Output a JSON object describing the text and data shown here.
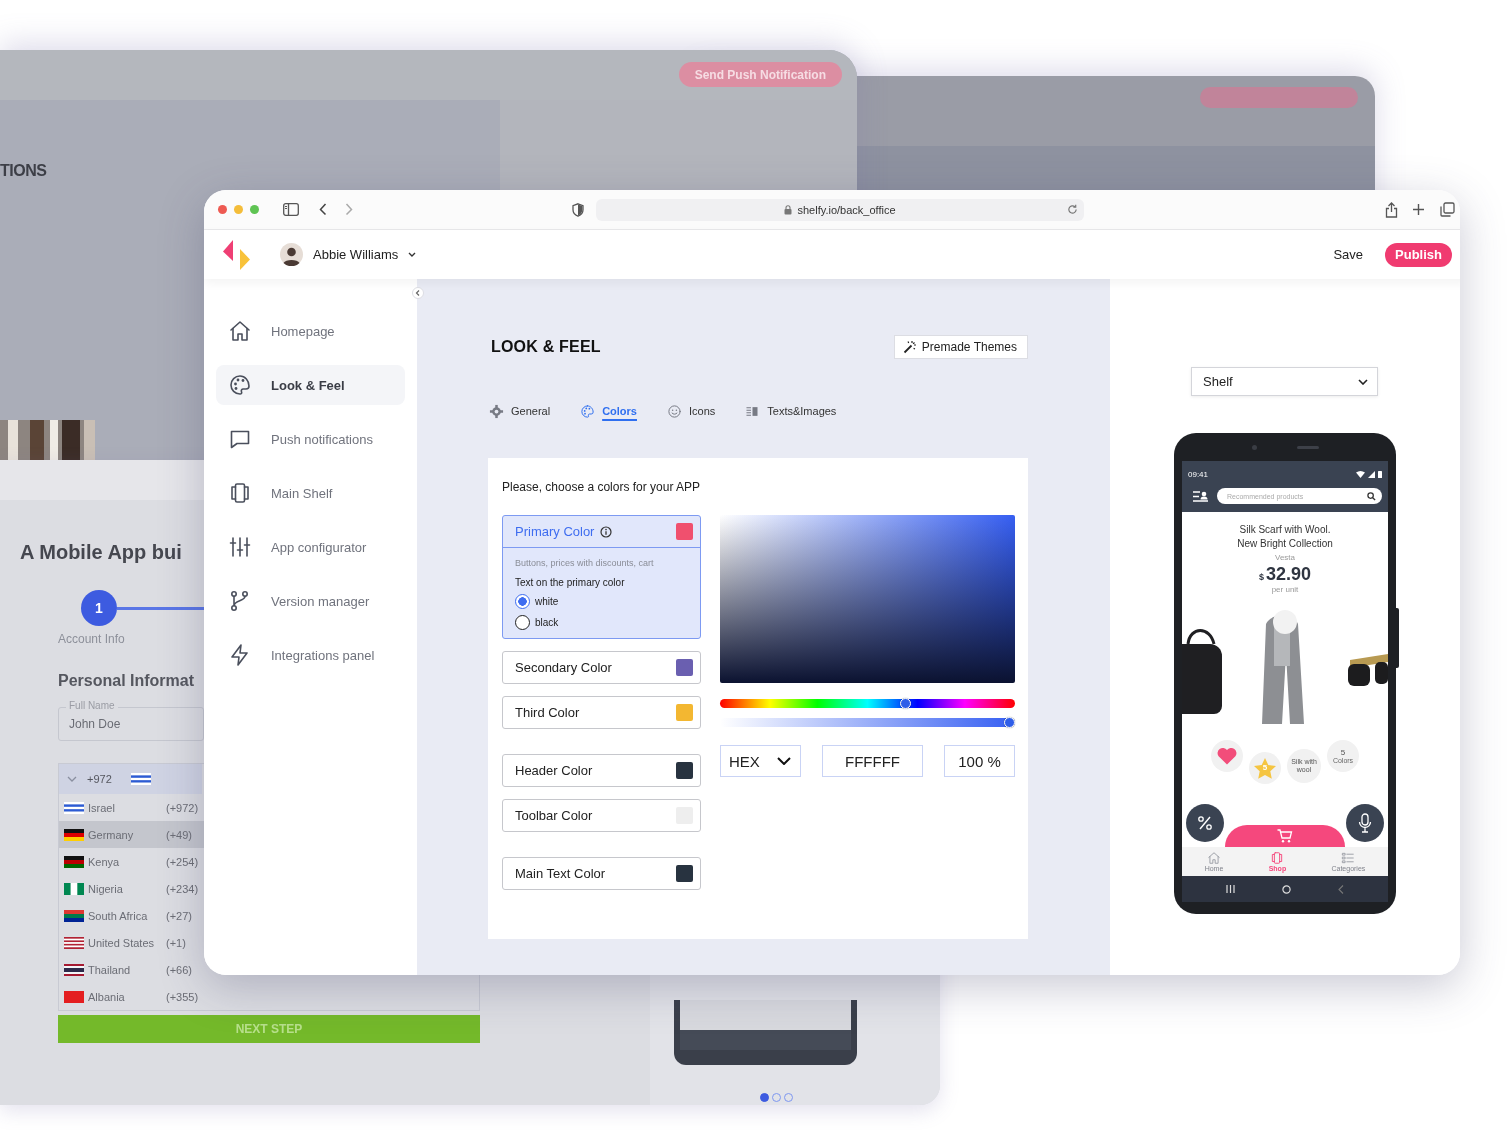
{
  "background_windows": {
    "push": {
      "heading": "TIONS",
      "button": "Send Push Notification"
    },
    "builder": {
      "title": "A Mobile App bui",
      "step": {
        "number": "1",
        "label": "Account Info"
      },
      "section": "Personal Informat",
      "full_name": {
        "label": "Full Name",
        "value": "John Doe"
      },
      "phone_code": "+972",
      "countries": [
        {
          "name": "Israel",
          "code": "(+972)",
          "selected": false
        },
        {
          "name": "Germany",
          "code": "(+49)",
          "selected": true
        },
        {
          "name": "Kenya",
          "code": "(+254)",
          "selected": false
        },
        {
          "name": "Nigeria",
          "code": "(+234)",
          "selected": false
        },
        {
          "name": "South Africa",
          "code": "(+27)",
          "selected": false
        },
        {
          "name": "United States",
          "code": "(+1)",
          "selected": false
        },
        {
          "name": "Thailand",
          "code": "(+66)",
          "selected": false
        },
        {
          "name": "Albania",
          "code": "(+355)",
          "selected": false
        }
      ],
      "next_button": "NEXT STEP",
      "pager": [
        {
          "selected": true
        },
        {
          "selected": false
        },
        {
          "selected": false
        }
      ]
    }
  },
  "browser": {
    "url": "shelfy.io/back_office"
  },
  "header": {
    "user": "Abbie Williams",
    "save": "Save",
    "publish": "Publish"
  },
  "sidebar": {
    "items": [
      {
        "label": "Homepage",
        "selected": false
      },
      {
        "label": "Look & Feel",
        "selected": true
      },
      {
        "label": "Push notifications",
        "selected": false
      },
      {
        "label": "Main Shelf",
        "selected": false
      },
      {
        "label": "App configurator",
        "selected": false
      },
      {
        "label": "Version manager",
        "selected": false
      },
      {
        "label": "Integrations panel",
        "selected": false
      }
    ]
  },
  "page": {
    "title": "LOOK & FEEL",
    "premade_button": "Premade Themes",
    "tabs": [
      {
        "label": "General",
        "selected": false
      },
      {
        "label": "Colors",
        "selected": true
      },
      {
        "label": "Icons",
        "selected": false
      },
      {
        "label": "Texts&Images",
        "selected": false
      }
    ],
    "prompt": "Please, choose a colors for your APP",
    "colors": [
      {
        "label": "Primary Color",
        "color": "#f0506e",
        "expanded": true,
        "info": true,
        "description": "Buttons, prices with discounts, cart",
        "option_label": "Text on the primary color",
        "options": [
          {
            "label": "white",
            "selected": true
          },
          {
            "label": "black",
            "selected": false
          }
        ]
      },
      {
        "label": "Secondary Color",
        "color": "#6a5fb0",
        "expanded": false
      },
      {
        "label": "Third Color",
        "color": "#f3b731",
        "expanded": false
      },
      {
        "label": "Header Color",
        "color": "#283340",
        "expanded": false
      },
      {
        "label": "Toolbar Color",
        "color": "#eeeeee",
        "expanded": false
      },
      {
        "label": "Main Text Color",
        "color": "#283340",
        "expanded": false
      }
    ],
    "picker": {
      "hue": {
        "level": 0.63
      },
      "alpha": {
        "level": 1
      },
      "format": "HEX",
      "value": "FFFFFF",
      "opacity": "100 %"
    }
  },
  "preview": {
    "dropdown": "Shelf",
    "phone": {
      "time": "09:41",
      "search_placeholder": "Recommended products",
      "title_lines": [
        "Silk Scarf with Wool.",
        "New Bright Collection"
      ],
      "brand": "Vesta",
      "currency": "$",
      "price": "32.90",
      "unit": "per unit",
      "chips": [
        {
          "kind": "heart"
        },
        {
          "kind": "rating",
          "text": "5"
        },
        {
          "kind": "text",
          "text": "Silk with wool"
        },
        {
          "kind": "count",
          "number": "5",
          "text": "Colors"
        }
      ],
      "nav": [
        {
          "label": "Home",
          "selected": false
        },
        {
          "label": "Shop",
          "selected": true
        },
        {
          "label": "Categories",
          "selected": false
        }
      ]
    }
  }
}
